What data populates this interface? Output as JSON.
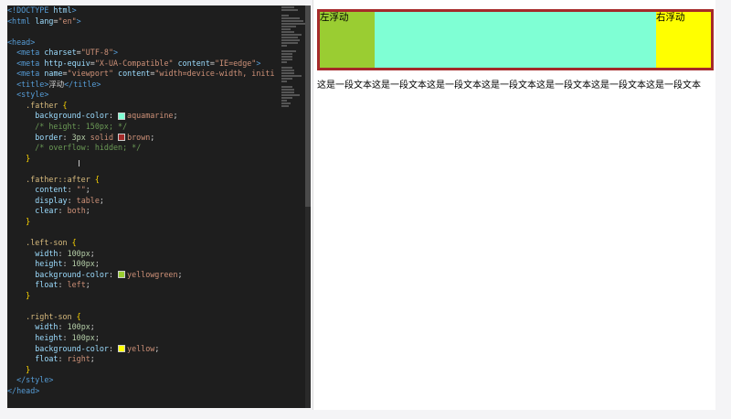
{
  "editor": {
    "lines": [
      [
        [
          "<!DOCTYPE ",
          "tag"
        ],
        [
          "html",
          "attr"
        ],
        [
          ">",
          "tag"
        ]
      ],
      [
        [
          "<html ",
          "tag"
        ],
        [
          "lang",
          "attr"
        ],
        [
          "=",
          "txt"
        ],
        [
          "\"en\"",
          "str"
        ],
        [
          ">",
          "tag"
        ]
      ],
      [
        [
          "",
          ""
        ]
      ],
      [
        [
          "<head>",
          "tag"
        ]
      ],
      [
        [
          "  ",
          "txt"
        ],
        [
          "<meta ",
          "tag"
        ],
        [
          "charset",
          "attr"
        ],
        [
          "=",
          "txt"
        ],
        [
          "\"UTF-8\"",
          "str"
        ],
        [
          ">",
          "tag"
        ]
      ],
      [
        [
          "  ",
          "txt"
        ],
        [
          "<meta ",
          "tag"
        ],
        [
          "http-equiv",
          "attr"
        ],
        [
          "=",
          "txt"
        ],
        [
          "\"X-UA-Compatible\"",
          "str"
        ],
        [
          " content",
          "attr"
        ],
        [
          "=",
          "txt"
        ],
        [
          "\"IE=edge\"",
          "str"
        ],
        [
          ">",
          "tag"
        ]
      ],
      [
        [
          "  ",
          "txt"
        ],
        [
          "<meta ",
          "tag"
        ],
        [
          "name",
          "attr"
        ],
        [
          "=",
          "txt"
        ],
        [
          "\"viewport\"",
          "str"
        ],
        [
          " content",
          "attr"
        ],
        [
          "=",
          "txt"
        ],
        [
          "\"width=device-width, initi",
          "str"
        ]
      ],
      [
        [
          "  ",
          "txt"
        ],
        [
          "<title>",
          "tag"
        ],
        [
          "浮动",
          "txt"
        ],
        [
          "</title>",
          "tag"
        ]
      ],
      [
        [
          "  ",
          "txt"
        ],
        [
          "<style>",
          "tag"
        ]
      ],
      [
        [
          "    ",
          "txt"
        ],
        [
          ".father ",
          "sel"
        ],
        [
          "{",
          "brace"
        ]
      ],
      [
        [
          "      ",
          "txt"
        ],
        [
          "background-color",
          "prop"
        ],
        [
          ": ",
          "txt"
        ],
        [
          "#sw:#7fffd4",
          "sw"
        ],
        [
          "aquamarine",
          "val"
        ],
        [
          ";",
          "txt"
        ]
      ],
      [
        [
          "      ",
          "txt"
        ],
        [
          "/* height: 150px; */",
          "com"
        ]
      ],
      [
        [
          "      ",
          "txt"
        ],
        [
          "border",
          "prop"
        ],
        [
          ": ",
          "txt"
        ],
        [
          "3px",
          "num"
        ],
        [
          " solid ",
          "val"
        ],
        [
          "#sw:#a52a2a",
          "sw"
        ],
        [
          "brown",
          "val"
        ],
        [
          ";",
          "txt"
        ]
      ],
      [
        [
          "      ",
          "txt"
        ],
        [
          "/* overflow: hidden; */",
          "com"
        ]
      ],
      [
        [
          "    ",
          "txt"
        ],
        [
          "}",
          "brace"
        ]
      ],
      [
        [
          "",
          ""
        ]
      ],
      [
        [
          "    ",
          "txt"
        ],
        [
          ".father::after ",
          "sel"
        ],
        [
          "{",
          "brace"
        ]
      ],
      [
        [
          "      ",
          "txt"
        ],
        [
          "content",
          "prop"
        ],
        [
          ": ",
          "txt"
        ],
        [
          "\"\"",
          "str"
        ],
        [
          ";",
          "txt"
        ]
      ],
      [
        [
          "      ",
          "txt"
        ],
        [
          "display",
          "prop"
        ],
        [
          ": ",
          "txt"
        ],
        [
          "table",
          "val"
        ],
        [
          ";",
          "txt"
        ]
      ],
      [
        [
          "      ",
          "txt"
        ],
        [
          "clear",
          "prop"
        ],
        [
          ": ",
          "txt"
        ],
        [
          "both",
          "val"
        ],
        [
          ";",
          "txt"
        ]
      ],
      [
        [
          "    ",
          "txt"
        ],
        [
          "}",
          "brace"
        ]
      ],
      [
        [
          "",
          ""
        ]
      ],
      [
        [
          "    ",
          "txt"
        ],
        [
          ".left-son ",
          "sel"
        ],
        [
          "{",
          "brace"
        ]
      ],
      [
        [
          "      ",
          "txt"
        ],
        [
          "width",
          "prop"
        ],
        [
          ": ",
          "txt"
        ],
        [
          "100px",
          "num"
        ],
        [
          ";",
          "txt"
        ]
      ],
      [
        [
          "      ",
          "txt"
        ],
        [
          "height",
          "prop"
        ],
        [
          ": ",
          "txt"
        ],
        [
          "100px",
          "num"
        ],
        [
          ";",
          "txt"
        ]
      ],
      [
        [
          "      ",
          "txt"
        ],
        [
          "background-color",
          "prop"
        ],
        [
          ": ",
          "txt"
        ],
        [
          "#sw:#9acd32",
          "sw"
        ],
        [
          "yellowgreen",
          "val"
        ],
        [
          ";",
          "txt"
        ]
      ],
      [
        [
          "      ",
          "txt"
        ],
        [
          "float",
          "prop"
        ],
        [
          ": ",
          "txt"
        ],
        [
          "left",
          "val"
        ],
        [
          ";",
          "txt"
        ]
      ],
      [
        [
          "    ",
          "txt"
        ],
        [
          "}",
          "brace"
        ]
      ],
      [
        [
          "",
          ""
        ]
      ],
      [
        [
          "    ",
          "txt"
        ],
        [
          ".right-son ",
          "sel"
        ],
        [
          "{",
          "brace"
        ]
      ],
      [
        [
          "      ",
          "txt"
        ],
        [
          "width",
          "prop"
        ],
        [
          ": ",
          "txt"
        ],
        [
          "100px",
          "num"
        ],
        [
          ";",
          "txt"
        ]
      ],
      [
        [
          "      ",
          "txt"
        ],
        [
          "height",
          "prop"
        ],
        [
          ": ",
          "txt"
        ],
        [
          "100px",
          "num"
        ],
        [
          ";",
          "txt"
        ]
      ],
      [
        [
          "      ",
          "txt"
        ],
        [
          "background-color",
          "prop"
        ],
        [
          ": ",
          "txt"
        ],
        [
          "#sw:#ffff00",
          "sw"
        ],
        [
          "yellow",
          "val"
        ],
        [
          ";",
          "txt"
        ]
      ],
      [
        [
          "      ",
          "txt"
        ],
        [
          "float",
          "prop"
        ],
        [
          ": ",
          "txt"
        ],
        [
          "right",
          "val"
        ],
        [
          ";",
          "txt"
        ]
      ],
      [
        [
          "    ",
          "txt"
        ],
        [
          "}",
          "brace"
        ]
      ],
      [
        [
          "  ",
          "txt"
        ],
        [
          "</style>",
          "tag"
        ]
      ],
      [
        [
          "</head>",
          "tag"
        ]
      ]
    ]
  },
  "preview": {
    "left_label": "左浮动",
    "right_label": "右浮动",
    "paragraph": "这是一段文本这是一段文本这是一段文本这是一段文本这是一段文本这是一段文本这是一段文本"
  },
  "colors": {
    "father_bg": "#7fffd4",
    "father_border": "#a52a2a",
    "left_bg": "#9acd32",
    "right_bg": "#ffff00"
  }
}
